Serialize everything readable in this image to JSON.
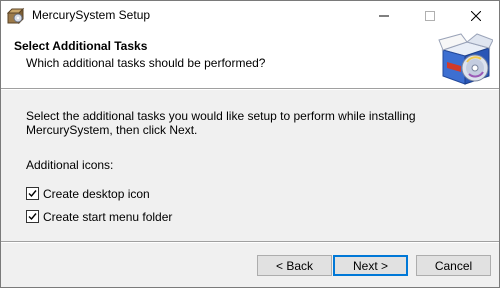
{
  "window": {
    "title": "MercurySystem Setup",
    "icon": "installer-icon",
    "controls": [
      "minimize-icon",
      "maximize-icon",
      "close-icon"
    ]
  },
  "header": {
    "title": "Select Additional Tasks",
    "subtitle": "Which additional tasks should be performed?",
    "art": "setup-box-cd-icon"
  },
  "body": {
    "description_line1": "Select the additional tasks you would like setup to perform while installing",
    "description_line2": "MercurySystem, then click Next.",
    "group_label": "Additional icons:",
    "tasks": [
      {
        "label": "Create desktop icon",
        "checked": true
      },
      {
        "label": "Create start menu folder",
        "checked": true
      }
    ]
  },
  "buttons": {
    "back": "< Back",
    "next": "Next >",
    "cancel": "Cancel"
  },
  "colors": {
    "accent": "#0078d7",
    "panel": "#f0f0f0",
    "header_bg": "#ffffff"
  }
}
